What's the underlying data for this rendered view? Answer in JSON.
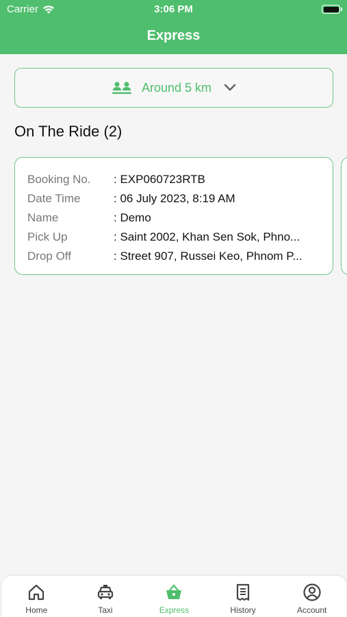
{
  "status_bar": {
    "carrier": "Carrier",
    "time": "3:06 PM"
  },
  "header": {
    "title": "Express"
  },
  "distance_filter": {
    "icon": "people-icon",
    "label": "Around 5 km"
  },
  "section": {
    "title": "On The Ride (2)"
  },
  "ride_card": {
    "booking_no": {
      "label": "Booking No.",
      "value": ": EXP060723RTB"
    },
    "date_time": {
      "label": "Date Time",
      "value": ": 06 July 2023, 8:19 AM"
    },
    "name": {
      "label": "Name",
      "value": ": Demo"
    },
    "pick_up": {
      "label": "Pick Up",
      "value": ": Saint 2002, Khan Sen Sok, Phno..."
    },
    "drop_off": {
      "label": "Drop Off",
      "value": ": Street 907, Russei Keo, Phnom P..."
    }
  },
  "tabs": [
    {
      "label": "Home",
      "icon": "home-icon"
    },
    {
      "label": "Taxi",
      "icon": "taxi-icon"
    },
    {
      "label": "Express",
      "icon": "basket-icon",
      "active": true
    },
    {
      "label": "History",
      "icon": "receipt-icon"
    },
    {
      "label": "Account",
      "icon": "account-icon"
    }
  ],
  "colors": {
    "brand": "#4fbe6e",
    "card_border": "#6cc786"
  }
}
